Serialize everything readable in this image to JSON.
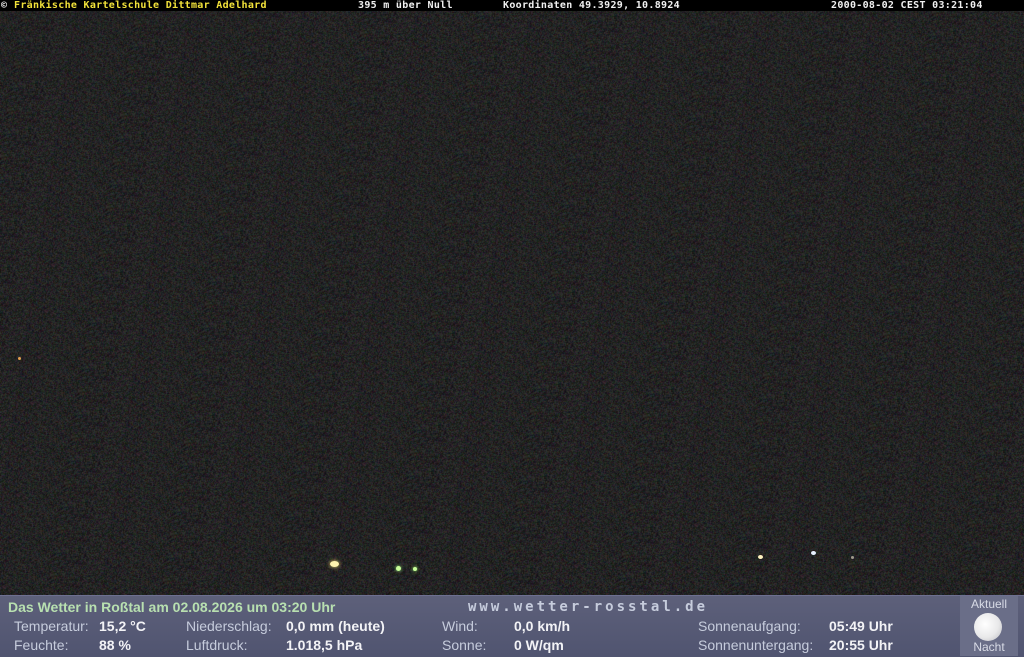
{
  "overlay": {
    "school": "Fränkische Kartelschule Dittmar Adelhard",
    "elevation": "395 m über Null",
    "coordinates": "Koordinaten 49.3929, 10.8924",
    "timestamp": "2000-08-02 CEST 03:21:04",
    "copyright_glyph": "©"
  },
  "panel": {
    "title": "Das Wetter in Roßtal am 02.08.2026 um 03:20 Uhr",
    "website": "www.wetter-rosstal.de",
    "rows": [
      {
        "label": "Temperatur:",
        "value": "15,2 °C"
      },
      {
        "label": "Feuchte:",
        "value": "88 %"
      },
      {
        "label": "Niederschlag:",
        "value": "0,0 mm (heute)"
      },
      {
        "label": "Luftdruck:",
        "value": "1.018,5 hPa"
      },
      {
        "label": "Wind:",
        "value": "0,0 km/h"
      },
      {
        "label": "Sonne:",
        "value": "0 W/qm"
      },
      {
        "label": "Sonnenaufgang:",
        "value": "05:49 Uhr"
      },
      {
        "label": "Sonnenuntergang:",
        "value": "20:55 Uhr"
      }
    ],
    "moon": {
      "top": "Aktuell",
      "bottom": "Nacht",
      "icon": "moon-icon"
    }
  },
  "colors": {
    "accent_yellow": "#f2e23a",
    "panel": "#5d607a",
    "title_green": "#b8e0b0"
  }
}
